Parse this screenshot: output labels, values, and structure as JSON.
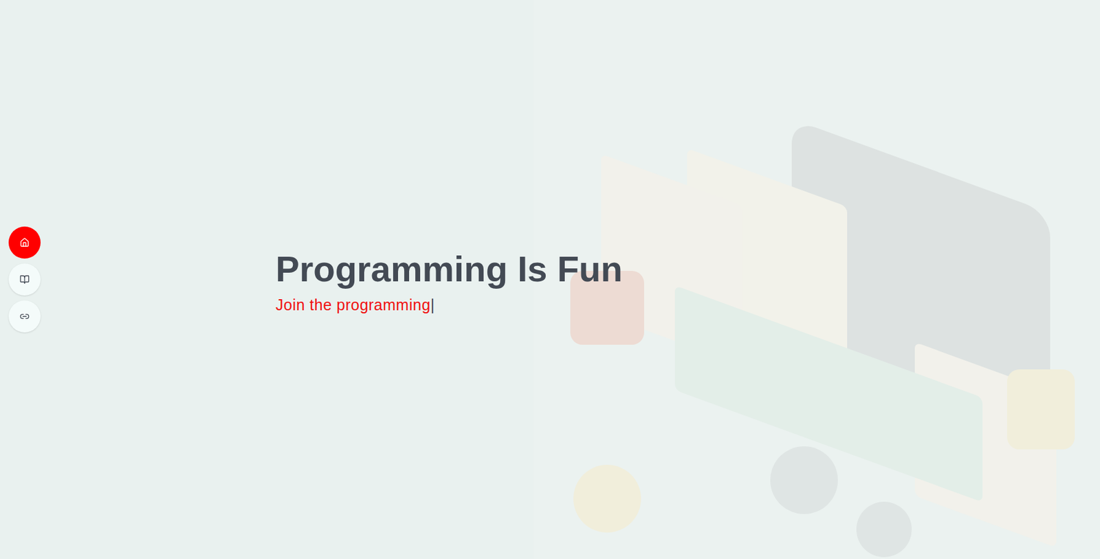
{
  "nav": {
    "items": [
      {
        "label": "Home",
        "selected": true
      },
      {
        "label": "Courses",
        "selected": false
      },
      {
        "label": "Links",
        "selected": false
      }
    ]
  },
  "hero": {
    "title": "Programming Is Fun",
    "subtitle": "Join the programming",
    "cursor": "|"
  }
}
